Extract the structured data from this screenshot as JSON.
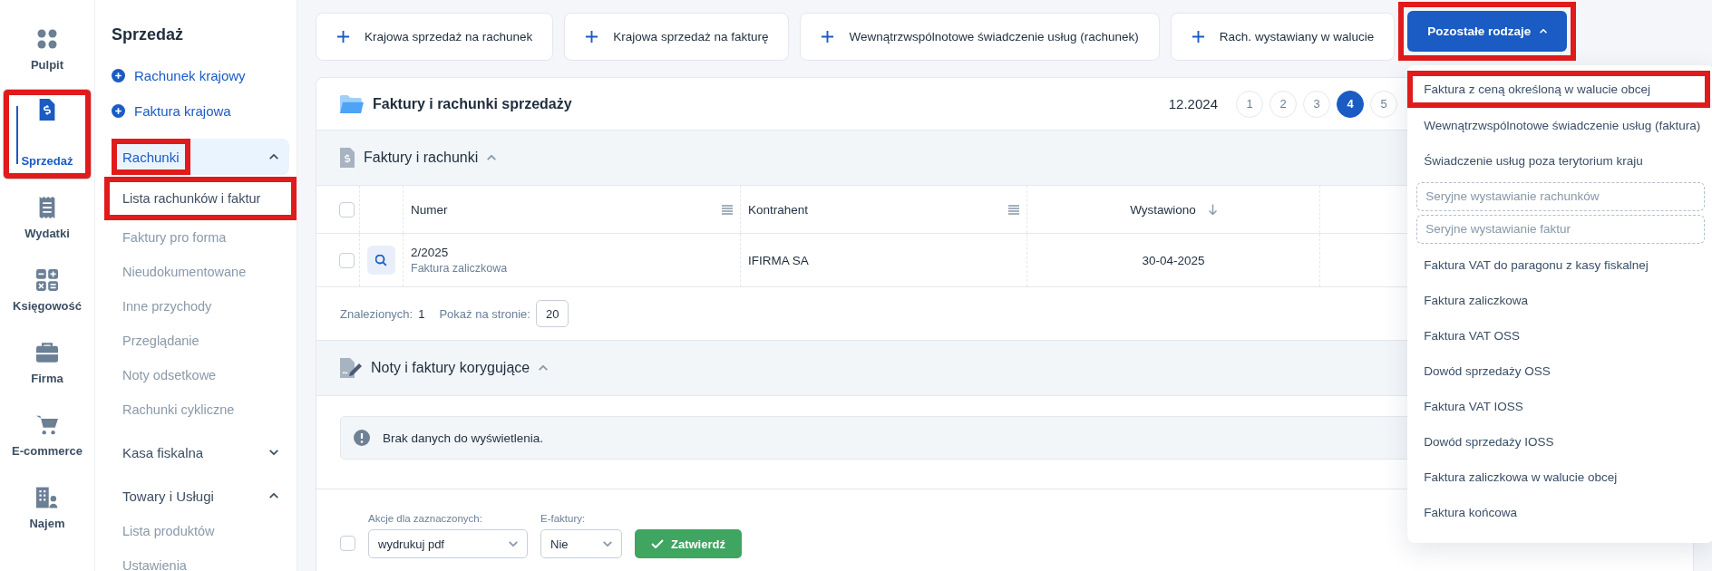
{
  "rail": [
    {
      "label": "Pulpit",
      "selected": false,
      "highlighted": false
    },
    {
      "label": "Sprzedaż",
      "selected": true,
      "highlighted": true
    },
    {
      "label": "Wydatki",
      "selected": false,
      "highlighted": false
    },
    {
      "label": "Księgowość",
      "selected": false,
      "highlighted": false
    },
    {
      "label": "Firma",
      "selected": false,
      "highlighted": false
    },
    {
      "label": "E-commerce",
      "selected": false,
      "highlighted": false
    },
    {
      "label": "Najem",
      "selected": false,
      "highlighted": false
    }
  ],
  "sidebar": {
    "title": "Sprzedaż",
    "quick_links": [
      "Rachunek krajowy",
      "Faktura krajowa"
    ],
    "groups": [
      {
        "label": "Rachunki",
        "expanded": true,
        "selected": true,
        "highlighted": true,
        "children": [
          {
            "label": "Lista rachunków i faktur",
            "selected": true,
            "highlighted": true
          },
          {
            "label": "Faktury pro forma",
            "selected": false,
            "highlighted": false
          },
          {
            "label": "Nieudokumentowane",
            "selected": false,
            "highlighted": false
          },
          {
            "label": "Inne przychody",
            "selected": false,
            "highlighted": false
          },
          {
            "label": "Przeglądanie",
            "selected": false,
            "highlighted": false
          },
          {
            "label": "Noty odsetkowe",
            "selected": false,
            "highlighted": false
          },
          {
            "label": "Rachunki cykliczne",
            "selected": false,
            "highlighted": false
          }
        ]
      },
      {
        "label": "Kasa fiskalna",
        "expanded": false,
        "selected": false,
        "highlighted": false
      },
      {
        "label": "Towary i Usługi",
        "expanded": true,
        "selected": false,
        "highlighted": false,
        "children": [
          {
            "label": "Lista produktów",
            "selected": false,
            "highlighted": false
          },
          {
            "label": "Ustawienia",
            "selected": false,
            "highlighted": false
          }
        ]
      }
    ]
  },
  "top_actions": [
    {
      "label": "Krajowa sprzedaż na rachunek",
      "kind": "add",
      "highlighted": false
    },
    {
      "label": "Krajowa sprzedaż na fakturę",
      "kind": "add",
      "highlighted": false
    },
    {
      "label": "Wewnątrzwspólnotowe  świadczenie usług (rachunek)",
      "kind": "add",
      "highlighted": false
    },
    {
      "label": "Rach. wystawiany w walucie",
      "kind": "add",
      "highlighted": false
    },
    {
      "label": "Pozostałe rodzaje",
      "kind": "menu",
      "expanded": true,
      "highlighted": true
    }
  ],
  "dropdown": [
    {
      "label": "Faktura z ceną określoną w walucie obcej",
      "kind": "item",
      "highlighted": true
    },
    {
      "label": "Wewnątrzwspólnotowe świadczenie usług (faktura)",
      "kind": "item",
      "highlighted": false
    },
    {
      "label": "Świadczenie usług poza terytorium kraju",
      "kind": "item",
      "highlighted": false
    },
    {
      "label": "Seryjne wystawianie rachunków",
      "kind": "batch",
      "highlighted": false
    },
    {
      "label": "Seryjne wystawianie faktur",
      "kind": "batch",
      "highlighted": false
    },
    {
      "label": "Faktura VAT do paragonu z kasy fiskalnej",
      "kind": "item",
      "highlighted": false
    },
    {
      "label": "Faktura zaliczkowa",
      "kind": "item",
      "highlighted": false
    },
    {
      "label": "Faktura VAT OSS",
      "kind": "item",
      "highlighted": false
    },
    {
      "label": "Dowód sprzedaży OSS",
      "kind": "item",
      "highlighted": false
    },
    {
      "label": "Faktura VAT IOSS",
      "kind": "item",
      "highlighted": false
    },
    {
      "label": "Dowód sprzedaży IOSS",
      "kind": "item",
      "highlighted": false
    },
    {
      "label": "Faktura zaliczkowa w walucie obcej",
      "kind": "item",
      "highlighted": false
    },
    {
      "label": "Faktura końcowa",
      "kind": "item",
      "highlighted": false
    }
  ],
  "card": {
    "title": "Faktury i rachunki sprzedaży",
    "period": "12.2024",
    "pages": [
      {
        "label": "1",
        "selected": false
      },
      {
        "label": "2",
        "selected": false
      },
      {
        "label": "3",
        "selected": false
      },
      {
        "label": "4",
        "selected": true
      },
      {
        "label": "5",
        "selected": false
      }
    ],
    "invoices": {
      "title": "Faktury i rachunki",
      "expanded": true,
      "select_all_checked": false,
      "columns": [
        {
          "label": "Numer",
          "menu": true
        },
        {
          "label": "Kontrahent",
          "menu": true
        },
        {
          "label": "Wystawiono",
          "menu": false
        }
      ],
      "rows": [
        {
          "checked": false,
          "number": "2/2025",
          "type": "Faktura zaliczkowa",
          "contractor": "IFIRMA SA",
          "issued": "30-04-2025"
        }
      ],
      "found_label": "Znalezionych:",
      "found": "1",
      "per_page_label": "Pokaż na stronie:",
      "per_page": "20"
    },
    "corrections": {
      "title": "Noty i faktury korygujące",
      "expanded": true,
      "empty_message": "Brak danych do wyświetlenia."
    },
    "bulk": {
      "checked": false,
      "actions_label": "Akcje dla zaznaczonych:",
      "actions_value": "wydrukuj pdf",
      "efaktury_label": "E-faktury:",
      "efaktury_value": "Nie",
      "confirm": "Zatwierdź"
    }
  }
}
